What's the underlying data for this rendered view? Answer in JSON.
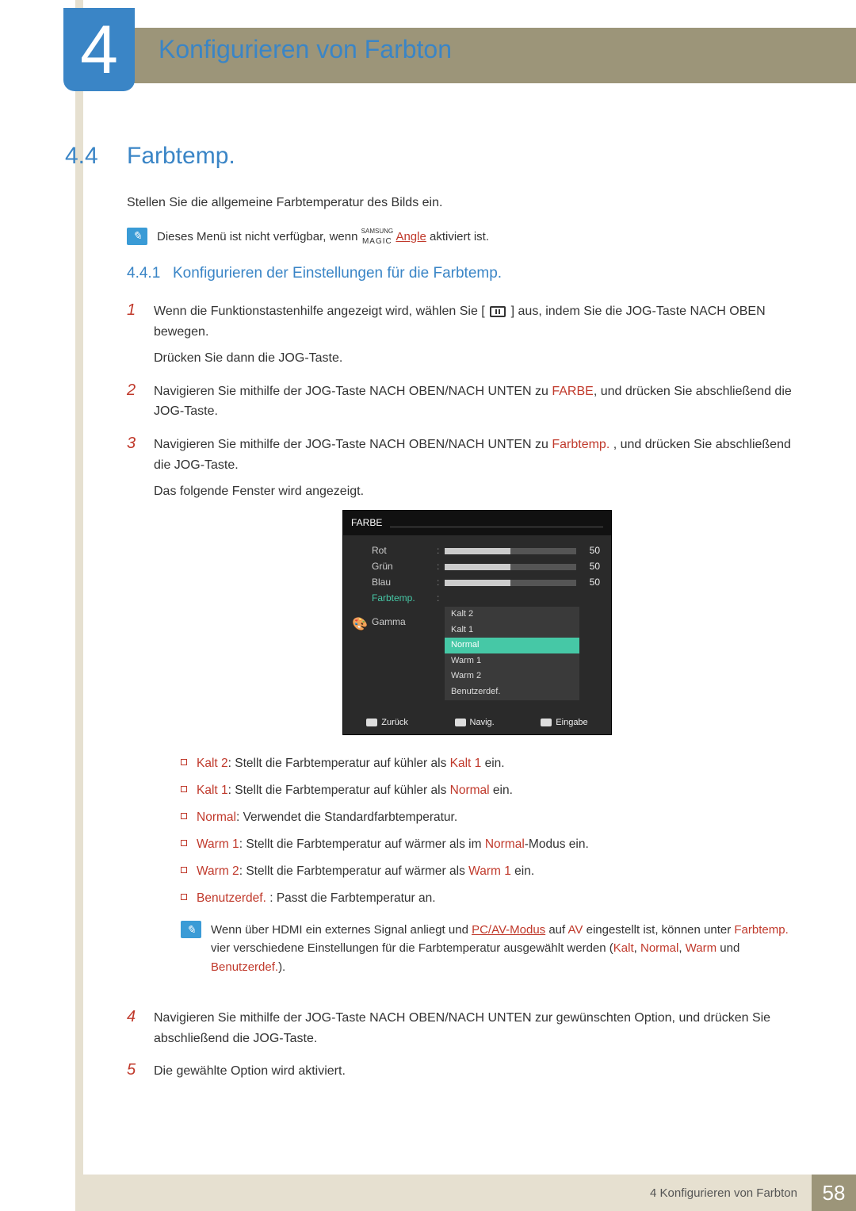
{
  "chapter": {
    "number": "4",
    "title": "Konfigurieren von Farbton"
  },
  "section": {
    "number": "4.4",
    "title": "Farbtemp."
  },
  "intro": "Stellen Sie die allgemeine Farbtemperatur des Bilds ein.",
  "note1": {
    "pre": "Dieses Menü ist nicht verfügbar, wenn ",
    "magic_top": "SAMSUNG",
    "magic_bottom": "MAGIC",
    "angle": "Angle",
    "post": " aktiviert ist."
  },
  "subsection": {
    "number": "4.4.1",
    "title": "Konfigurieren der Einstellungen für die Farbtemp."
  },
  "steps": {
    "s1": {
      "a": "Wenn die Funktionstastenhilfe angezeigt wird, wählen Sie [",
      "b": "] aus, indem Sie die JOG-Taste NACH OBEN bewegen.",
      "c": "Drücken Sie dann die JOG-Taste."
    },
    "s2": {
      "a": "Navigieren Sie mithilfe der JOG-Taste NACH OBEN/NACH UNTEN zu ",
      "hl": "FARBE",
      "b": ", und drücken Sie abschließend die JOG-Taste."
    },
    "s3": {
      "a": "Navigieren Sie mithilfe der JOG-Taste NACH OBEN/NACH UNTEN zu ",
      "hl": "Farbtemp.",
      "b": " , und drücken Sie abschließend die JOG-Taste.",
      "c": "Das folgende Fenster wird angezeigt."
    },
    "s4": "Navigieren Sie mithilfe der JOG-Taste NACH OBEN/NACH UNTEN zur gewünschten Option, und drücken Sie abschließend die JOG-Taste.",
    "s5": "Die gewählte Option wird aktiviert."
  },
  "osd": {
    "title": "FARBE",
    "rows": {
      "rot": {
        "label": "Rot",
        "value": "50"
      },
      "gruen": {
        "label": "Grün",
        "value": "50"
      },
      "blau": {
        "label": "Blau",
        "value": "50"
      },
      "farbtemp": {
        "label": "Farbtemp."
      },
      "gamma": {
        "label": "Gamma"
      }
    },
    "dropdown": [
      "Kalt 2",
      "Kalt 1",
      "Normal",
      "Warm 1",
      "Warm 2",
      "Benutzerdef."
    ],
    "footer": {
      "back": "Zurück",
      "nav": "Navig.",
      "enter": "Eingabe"
    }
  },
  "options": {
    "kalt2": {
      "name": "Kalt 2",
      "sep": ": ",
      "t1": "Stellt die Farbtemperatur auf kühler als ",
      "ref": "Kalt 1",
      "t2": " ein."
    },
    "kalt1": {
      "name": "Kalt 1",
      "sep": ": ",
      "t1": "Stellt die Farbtemperatur auf kühler als ",
      "ref": "Normal",
      "t2": " ein."
    },
    "normal": {
      "name": "Normal",
      "sep": ": ",
      "t1": "Verwendet die Standardfarbtemperatur."
    },
    "warm1": {
      "name": "Warm 1",
      "sep": ": ",
      "t1": "Stellt die Farbtemperatur auf wärmer als im ",
      "ref": "Normal",
      "t2": "-Modus ein."
    },
    "warm2": {
      "name": "Warm 2",
      "sep": ": ",
      "t1": "Stellt die Farbtemperatur auf wärmer als ",
      "ref": "Warm 1",
      "t2": " ein."
    },
    "benutz": {
      "name": "Benutzerdef.",
      "sep": " : ",
      "t1": "Passt die Farbtemperatur an."
    }
  },
  "note2": {
    "a": "Wenn über HDMI ein externes Signal anliegt und ",
    "pcav": "PC/AV-Modus",
    "b": " auf ",
    "av": "AV",
    "c": " eingestellt ist, können unter ",
    "farbtemp": "Farbtemp.",
    "d": " vier verschiedene Einstellungen für die Farbtemperatur ausgewählt werden (",
    "k": "Kalt",
    "comma1": ", ",
    "n": "Normal",
    "comma2": ", ",
    "w": "Warm",
    "and": " und ",
    "be": "Benutzerdef.",
    "end": ")."
  },
  "footer": {
    "text": "4 Konfigurieren von Farbton",
    "page": "58"
  }
}
